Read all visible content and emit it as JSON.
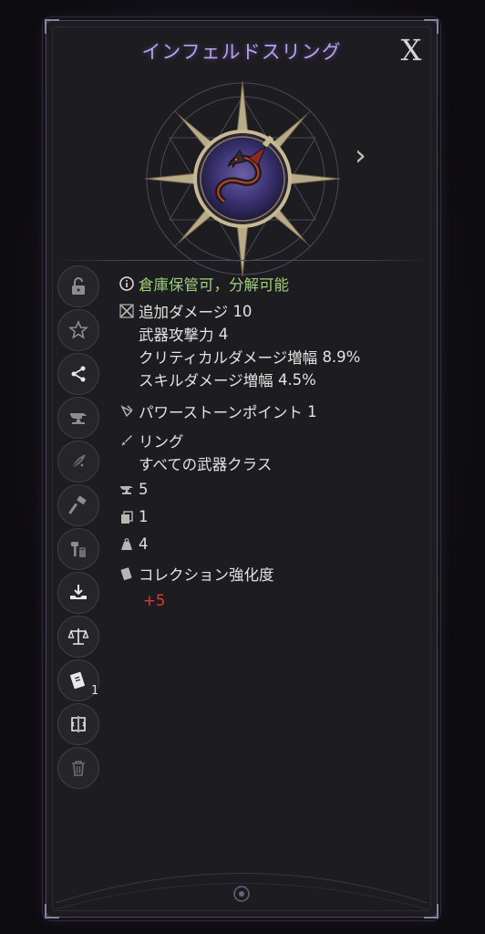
{
  "item": {
    "name": "インフェルドスリング",
    "close_label": "X",
    "next_label": "›"
  },
  "status": {
    "storage_text": "倉庫保管可，分解可能"
  },
  "stats": {
    "primary_label": "追加ダメージ",
    "primary_value": "10",
    "sub": [
      {
        "label": "武器攻撃力",
        "value": "4"
      },
      {
        "label": "クリティカルダメージ増幅",
        "value": "8.9%"
      },
      {
        "label": "スキルダメージ増幅",
        "value": "4.5%"
      }
    ]
  },
  "powerstone": {
    "label": "パワーストーンポイント",
    "value": "1"
  },
  "type": {
    "label": "リング",
    "class_text": "すべての武器クラス"
  },
  "counts": {
    "enhance": "5",
    "copies": "1",
    "weight": "4"
  },
  "collection": {
    "label": "コレクション強化度",
    "value": "+5"
  },
  "sidebar": {
    "book_badge": "1",
    "buttons": [
      "lock-icon",
      "star-icon",
      "share-icon",
      "anvil-icon",
      "feather-icon",
      "hammer-icon",
      "repair-icon",
      "deposit-icon",
      "scale-icon",
      "book-icon",
      "compare-icon",
      "trash-icon"
    ]
  },
  "colors": {
    "title": "#b7a2ec",
    "status_green": "#9dcf7a",
    "collection_red": "#e23a2a",
    "panel_bg": "#1d1c20"
  }
}
